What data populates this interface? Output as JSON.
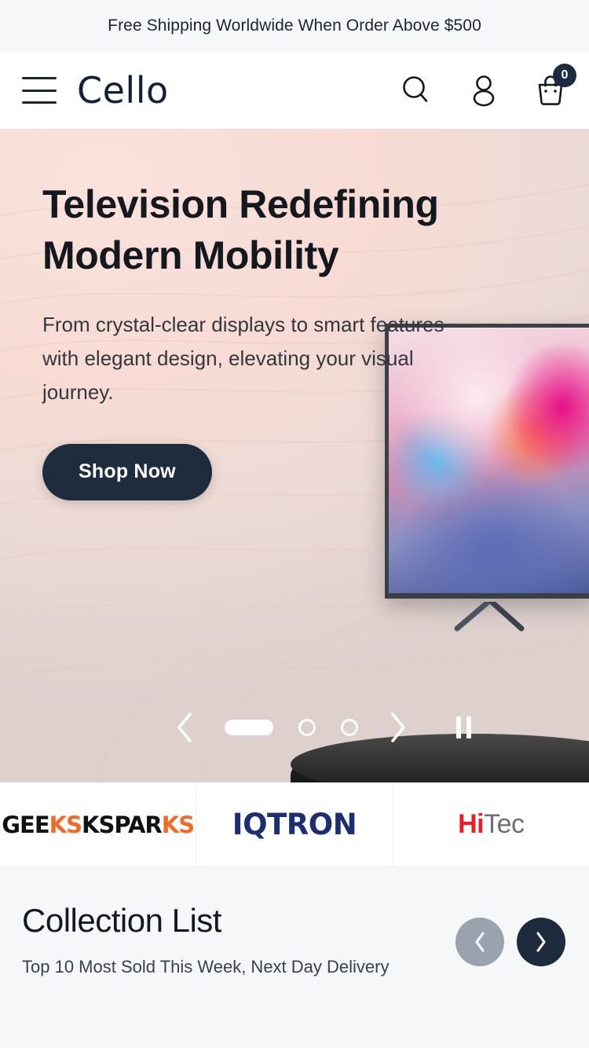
{
  "announcement": {
    "text": "Free Shipping Worldwide When Order Above $500"
  },
  "header": {
    "brand": "Cello",
    "menu_icon": "hamburger-menu-icon",
    "search_icon": "search-icon",
    "account_icon": "user-account-icon",
    "cart_icon": "shopping-cart-icon",
    "cart_count": "0"
  },
  "hero": {
    "title": "Television Redefining\nModern Mobility",
    "subtitle": "From crystal-clear displays to smart features\nwith elegant design, elevating your visual\njourney.",
    "cta_label": "Shop Now",
    "carousel": {
      "prev_icon": "chevron-left-icon",
      "next_icon": "chevron-right-icon",
      "pause_icon": "pause-icon",
      "active_slide": 1,
      "total_slides": 3
    },
    "colors": {
      "background_top": "#f9e0d9",
      "background_bottom": "#ddd0cd",
      "cta_background": "#1f2c3e"
    }
  },
  "brands": [
    {
      "name": "GEEKSPARKS",
      "part_a": "GEE",
      "part_b": "KSPAR",
      "part_c": "KS",
      "color": "#111214",
      "accent": "#f06a2a"
    },
    {
      "name": "IQTRON",
      "text": "IQTRON",
      "color": "#1b2f72",
      "accent": "#d52b1e"
    },
    {
      "name": "HiTec",
      "part_a": "Hi",
      "part_b": "Tec",
      "color": "#ee1c25",
      "accent": "#6b6f75"
    }
  ],
  "collection": {
    "title": "Collection List",
    "subtitle": "Top 10 Most Sold This Week, Next Day Delivery",
    "prev_icon": "chevron-left-icon",
    "next_icon": "chevron-right-icon",
    "prev_color": "#9aa3ad",
    "next_color": "#1e2b3c"
  }
}
